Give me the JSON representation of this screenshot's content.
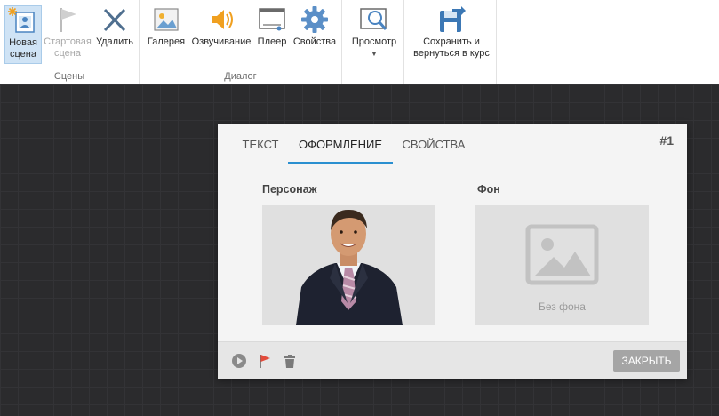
{
  "ribbon": {
    "groups": [
      {
        "title": "Сцены",
        "buttons": [
          {
            "line1": "Новая",
            "line2": "сцена",
            "icon": "new-scene-icon"
          },
          {
            "line1": "Стартовая",
            "line2": "сцена",
            "icon": "flag-icon"
          },
          {
            "line1": "Удалить",
            "line2": "",
            "icon": "delete-x-icon"
          }
        ]
      },
      {
        "title": "Диалог",
        "buttons": [
          {
            "line1": "Галерея",
            "icon": "gallery-icon"
          },
          {
            "line1": "Озвучивание",
            "icon": "speaker-icon"
          },
          {
            "line1": "Плеер",
            "icon": "player-icon"
          },
          {
            "line1": "Свойства",
            "icon": "gear-icon"
          }
        ]
      },
      {
        "title": "",
        "buttons": [
          {
            "line1": "Просмотр",
            "icon": "preview-icon",
            "caret": "▼"
          }
        ]
      },
      {
        "title": "",
        "buttons": [
          {
            "line1": "Сохранить и",
            "line2": "вернуться в курс",
            "icon": "save-icon"
          }
        ]
      }
    ]
  },
  "scene_card": {
    "tabs": [
      "ТЕКСТ",
      "ОФОРМЛЕНИЕ",
      "СВОЙСТВА"
    ],
    "active_tab": "ОФОРМЛЕНИЕ",
    "scene_number": "#1",
    "character_label": "Персонаж",
    "background_label": "Фон",
    "no_background_text": "Без фона",
    "close_label": "ЗАКРЫТЬ"
  },
  "colors": {
    "accent": "#2a8fd0",
    "flag": "#e24b3b",
    "gear": "#5b8fc7",
    "speaker": "#f0a020"
  }
}
